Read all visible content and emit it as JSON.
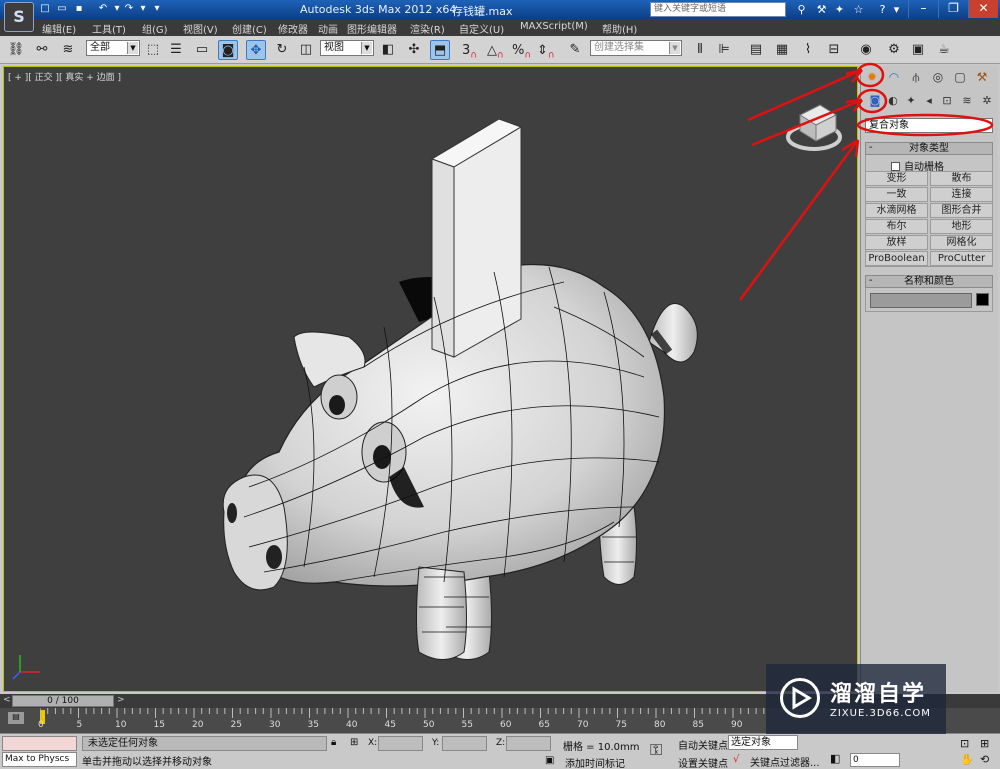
{
  "titlebar": {
    "app_title": "Autodesk 3ds Max  2012 x64",
    "file_name": "存钱罐.max",
    "search_placeholder": "键入关键字或短语",
    "logo_text": "S"
  },
  "menu": [
    "编辑(E)",
    "工具(T)",
    "组(G)",
    "视图(V)",
    "创建(C)",
    "修改器",
    "动画",
    "图形编辑器",
    "渲染(R)",
    "自定义(U)",
    "MAXScript(M)",
    "帮助(H)"
  ],
  "toolbar": {
    "selection_filter": "全部",
    "reference_coord": "视图",
    "named_selection_placeholder": "创建选择集",
    "snap_labels": [
      "3",
      "2.5"
    ],
    "percent_label": "%"
  },
  "viewport": {
    "label": "[ + ][ 正交 ][ 真实 + 边面 ]"
  },
  "command_panel": {
    "category_dropdown": "复合对象",
    "object_type_title": "对象类型",
    "autogrid_label": "自动栅格",
    "object_buttons": [
      "变形",
      "散布",
      "一致",
      "连接",
      "水滴网格",
      "图形合并",
      "布尔",
      "地形",
      "放样",
      "网格化",
      "ProBoolean",
      "ProCutter"
    ],
    "name_color_title": "名称和颜色"
  },
  "timeslider": {
    "frame_label": "0 / 100",
    "ruler_labels": [
      "0",
      "5",
      "10",
      "15",
      "20",
      "25",
      "30",
      "35",
      "40",
      "45",
      "50",
      "55",
      "60",
      "65",
      "70",
      "75",
      "80",
      "85",
      "90"
    ]
  },
  "statusbar": {
    "maxscript_text": "Max to Physcs",
    "status": "未选定任何对象",
    "prompt": "单击并拖动以选择并移动对象",
    "x_label": "X:",
    "y_label": "Y:",
    "z_label": "Z:",
    "grid": "栅格 = 10.0mm",
    "add_time_tag": "添加时间标记",
    "auto_key": "自动关键点",
    "set_key": "设置关键点",
    "selection_dropdown": "选定对象",
    "key_filters": "关键点过滤器...",
    "current_frame": "0"
  },
  "watermark": {
    "title": "溜溜自学",
    "url": "ZIXUE.3D66.COM"
  },
  "colors": {
    "annotation": "#e01010",
    "viewport_bg": "#3f3f3f",
    "active_border": "#bfbf00",
    "title_blue": "#1e62b8"
  }
}
